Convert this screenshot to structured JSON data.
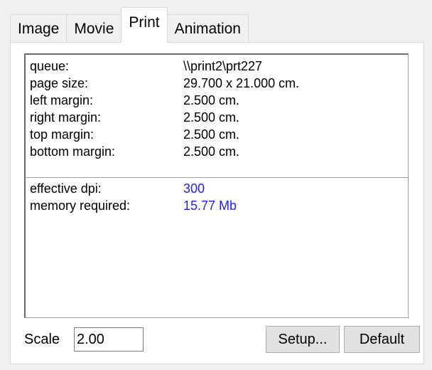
{
  "tabs": [
    {
      "label": "Image"
    },
    {
      "label": "Movie"
    },
    {
      "label": "Print",
      "active": true
    },
    {
      "label": "Animation"
    }
  ],
  "print_info": {
    "queue": {
      "label": "queue:",
      "value": "\\\\print2\\prt227"
    },
    "page_size": {
      "label": "page size:",
      "value": "29.700 x 21.000 cm."
    },
    "left_margin": {
      "label": "left margin:",
      "value": "2.500 cm."
    },
    "right_margin": {
      "label": "right margin:",
      "value": "2.500 cm."
    },
    "top_margin": {
      "label": "top margin:",
      "value": "2.500 cm."
    },
    "bottom_margin": {
      "label": "bottom margin:",
      "value": "2.500 cm."
    },
    "effective_dpi": {
      "label": "effective dpi:",
      "value": "300"
    },
    "memory_required": {
      "label": "memory required:",
      "value": "15.77 Mb"
    }
  },
  "scale": {
    "label": "Scale",
    "value": "2.00"
  },
  "buttons": {
    "setup": "Setup...",
    "default": "Default"
  },
  "colors": {
    "computed_value": "#1e1eff",
    "background": "#f0f0f0"
  }
}
